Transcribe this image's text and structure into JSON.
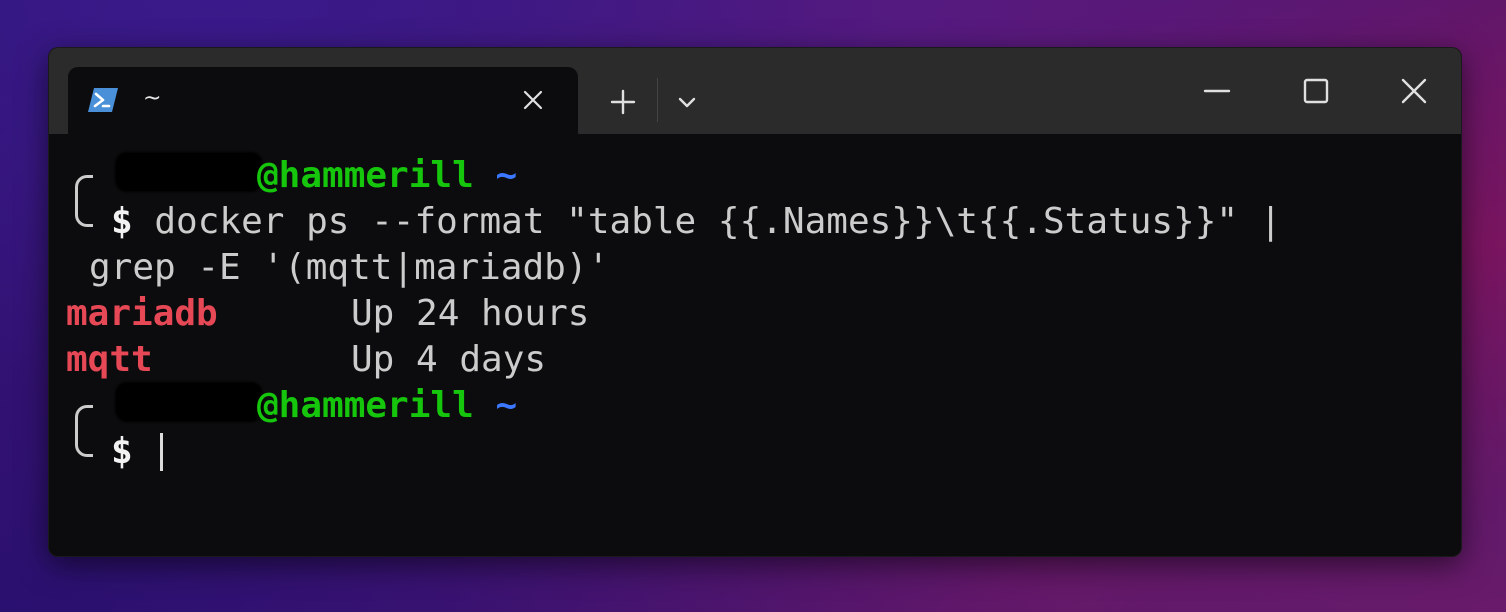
{
  "tab": {
    "title": "~",
    "icon": "powershell-icon"
  },
  "titlebar": {
    "new_tab_icon": "plus-icon",
    "dropdown_icon": "chevron-down-icon",
    "minimize_icon": "minimize-icon",
    "maximize_icon": "maximize-icon",
    "close_icon": "close-icon"
  },
  "terminal": {
    "prompt1": {
      "host": "@hammerill",
      "path": "~",
      "symbol": "$"
    },
    "command_line1": "docker ps --format \"table {{.Names}}\\t{{.Status}}\" |",
    "command_line2": "grep -E '(mqtt|mariadb)'",
    "output": [
      {
        "name": "mariadb",
        "status": "Up 24 hours"
      },
      {
        "name": "mqtt",
        "status": "Up 4 days"
      }
    ],
    "prompt2": {
      "host": "@hammerill",
      "path": "~",
      "symbol": "$"
    }
  },
  "colors": {
    "host": "#16c60c",
    "path": "#3b78ff",
    "output_name": "#e74856",
    "text": "#cccccc",
    "terminal_bg": "#0c0c0e",
    "titlebar_bg": "#2b2b2b"
  }
}
